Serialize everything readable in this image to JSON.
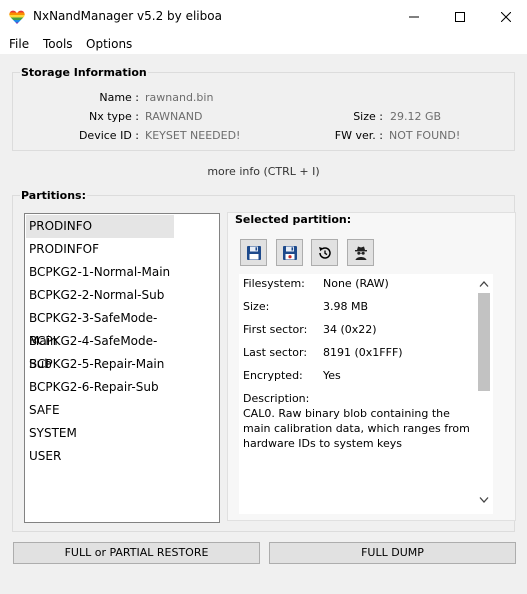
{
  "window": {
    "title": "NxNandManager v5.2 by eliboa"
  },
  "menu": {
    "items": [
      "File",
      "Tools",
      "Options"
    ]
  },
  "storage": {
    "title": "Storage Information",
    "name_label": "Name :",
    "name_value": "rawnand.bin",
    "type_label": "Nx type :",
    "type_value": "RAWNAND",
    "device_label": "Device ID :",
    "device_value": "KEYSET NEEDED!",
    "size_label": "Size :",
    "size_value": "29.12 GB",
    "fw_label": "FW ver. :",
    "fw_value": "NOT FOUND!"
  },
  "more_info": "more info (CTRL + I)",
  "partitions": {
    "title": "Partitions:",
    "items": [
      "PRODINFO",
      "PRODINFOF",
      "BCPKG2-1-Normal-Main",
      "BCPKG2-2-Normal-Sub",
      "BCPKG2-3-SafeMode-Main",
      "BCPKG2-4-SafeMode-Sub",
      "BCPKG2-5-Repair-Main",
      "BCPKG2-6-Repair-Sub",
      "SAFE",
      "SYSTEM",
      "USER"
    ],
    "selected": "PRODINFO"
  },
  "selected_partition": {
    "title": "Selected partition:",
    "tools": [
      "save-icon",
      "save-decrypt-icon",
      "restore-icon",
      "spy-icon"
    ],
    "filesystem_label": "Filesystem:",
    "filesystem_value": "None (RAW)",
    "size_label": "Size:",
    "size_value": "3.98 MB",
    "first_sector_label": "First sector:",
    "first_sector_value": "34 (0x22)",
    "last_sector_label": "Last sector:",
    "last_sector_value": "8191 (0x1FFF)",
    "encrypted_label": "Encrypted:",
    "encrypted_value": "Yes",
    "description_label": "Description:",
    "description_value": "CAL0. Raw binary blob containing the main calibration data, which ranges from hardware IDs to system keys"
  },
  "buttons": {
    "restore": "FULL or PARTIAL RESTORE",
    "dump": "FULL DUMP"
  },
  "colors": {
    "accent": "#1e4a8c",
    "value_gray": "#6d6d6d"
  }
}
